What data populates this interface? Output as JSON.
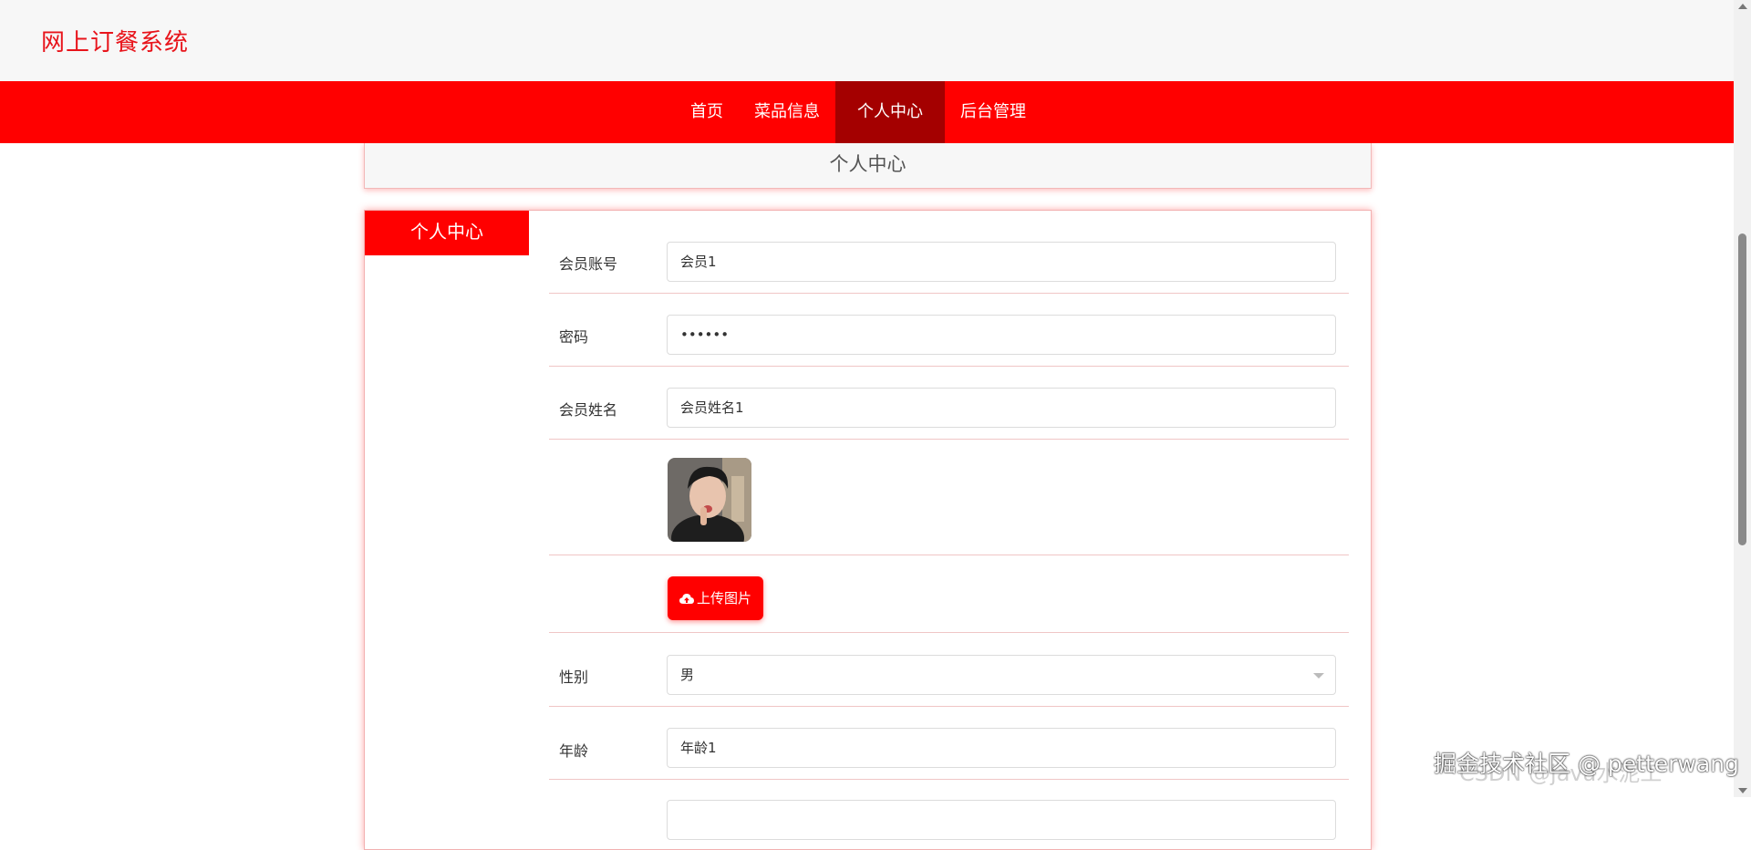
{
  "header": {
    "site_title": "网上订餐系统"
  },
  "nav": {
    "items": [
      {
        "label": "首页",
        "active": false
      },
      {
        "label": "菜品信息",
        "active": false
      },
      {
        "label": "个人中心",
        "active": true
      },
      {
        "label": "后台管理",
        "active": false
      }
    ]
  },
  "section": {
    "title": "个人中心"
  },
  "sidebar": {
    "tab_label": "个人中心"
  },
  "form": {
    "account": {
      "label": "会员账号",
      "value": "会员1"
    },
    "password": {
      "label": "密码",
      "value": "••••••"
    },
    "name": {
      "label": "会员姓名",
      "value": "会员姓名1"
    },
    "upload": {
      "label": "上传图片"
    },
    "gender": {
      "label": "性别",
      "value": "男"
    },
    "age": {
      "label": "年龄",
      "value": "年龄1"
    }
  },
  "watermark": {
    "text": "掘金技术社区 @ petterwang",
    "faint": "CSDN @java水泥工"
  },
  "colors": {
    "brand_red": "#ff0000",
    "active_nav": "#a40000",
    "title_red": "#e8141b"
  }
}
